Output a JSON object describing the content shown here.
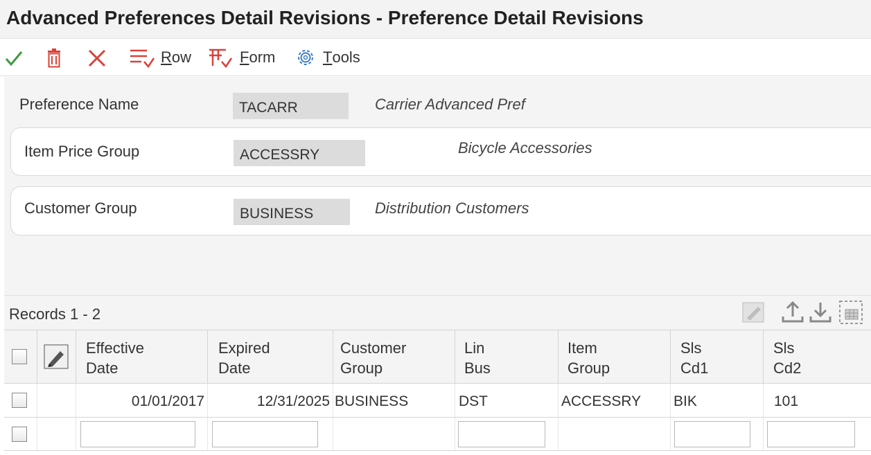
{
  "window": {
    "title": "Advanced Preferences Detail Revisions - Preference Detail Revisions"
  },
  "toolbar": {
    "ok_icon": "checkmark-icon",
    "delete_icon": "trash-icon",
    "cancel_icon": "close-icon",
    "row_menu": {
      "label": "Row",
      "mnemonic": "R",
      "rest": "ow",
      "icon": "row-menu-icon"
    },
    "form_menu": {
      "label": "Form",
      "mnemonic": "F",
      "rest": "orm",
      "icon": "form-menu-icon"
    },
    "tools_menu": {
      "label": "Tools",
      "mnemonic": "T",
      "rest": "ools",
      "icon": "gear-icon"
    }
  },
  "header": {
    "preference_name": {
      "label": "Preference Name",
      "value": "TACARR",
      "description": "Carrier Advanced Pref"
    },
    "item_price_group": {
      "label": "Item Price Group",
      "value": "ACCESSRY",
      "description": "Bicycle Accessories"
    },
    "customer_group": {
      "label": "Customer Group",
      "value": "BUSINESS",
      "description": "Distribution Customers"
    }
  },
  "grid": {
    "records_label": "Records 1 - 2",
    "columns": [
      {
        "line1": "Effective",
        "line2": "Date"
      },
      {
        "line1": "Expired",
        "line2": "Date"
      },
      {
        "line1": "Customer",
        "line2": "Group"
      },
      {
        "line1": "Lin",
        "line2": "Bus"
      },
      {
        "line1": "Item",
        "line2": "Group"
      },
      {
        "line1": "Sls",
        "line2": "Cd1"
      },
      {
        "line1": "Sls",
        "line2": "Cd2"
      }
    ],
    "rows": [
      {
        "effective_date": "01/01/2017",
        "expired_date": "12/31/2025",
        "customer_group": "BUSINESS",
        "lin_bus": "DST",
        "item_group": "ACCESSRY",
        "sls_cd1": "BIK",
        "sls_cd2": "101"
      }
    ]
  },
  "colors": {
    "accent_red": "#d9413a",
    "ok_green": "#3c9a3c",
    "link_blue": "#3a7bc8"
  }
}
